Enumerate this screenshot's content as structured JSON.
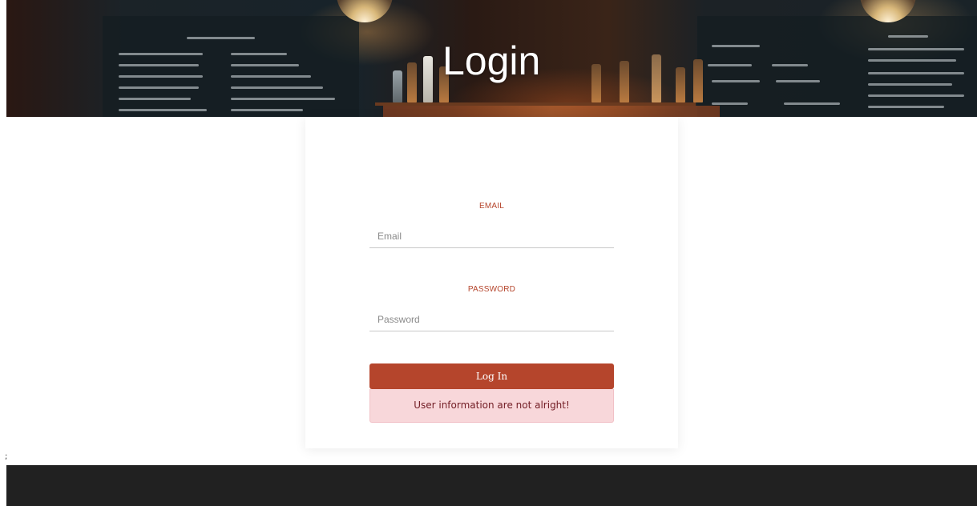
{
  "hero": {
    "title": "Login"
  },
  "form": {
    "email": {
      "label": "EMAIL",
      "placeholder": "Email",
      "value": ""
    },
    "password": {
      "label": "PASSWORD",
      "placeholder": "Password",
      "value": ""
    },
    "submit_label": "Log In",
    "error_message": "User information are not alright!"
  },
  "stray_text": ";",
  "colors": {
    "accent": "#b5452c",
    "alert_background": "#f8d7da",
    "alert_text": "#721c24",
    "footer": "#212121"
  }
}
